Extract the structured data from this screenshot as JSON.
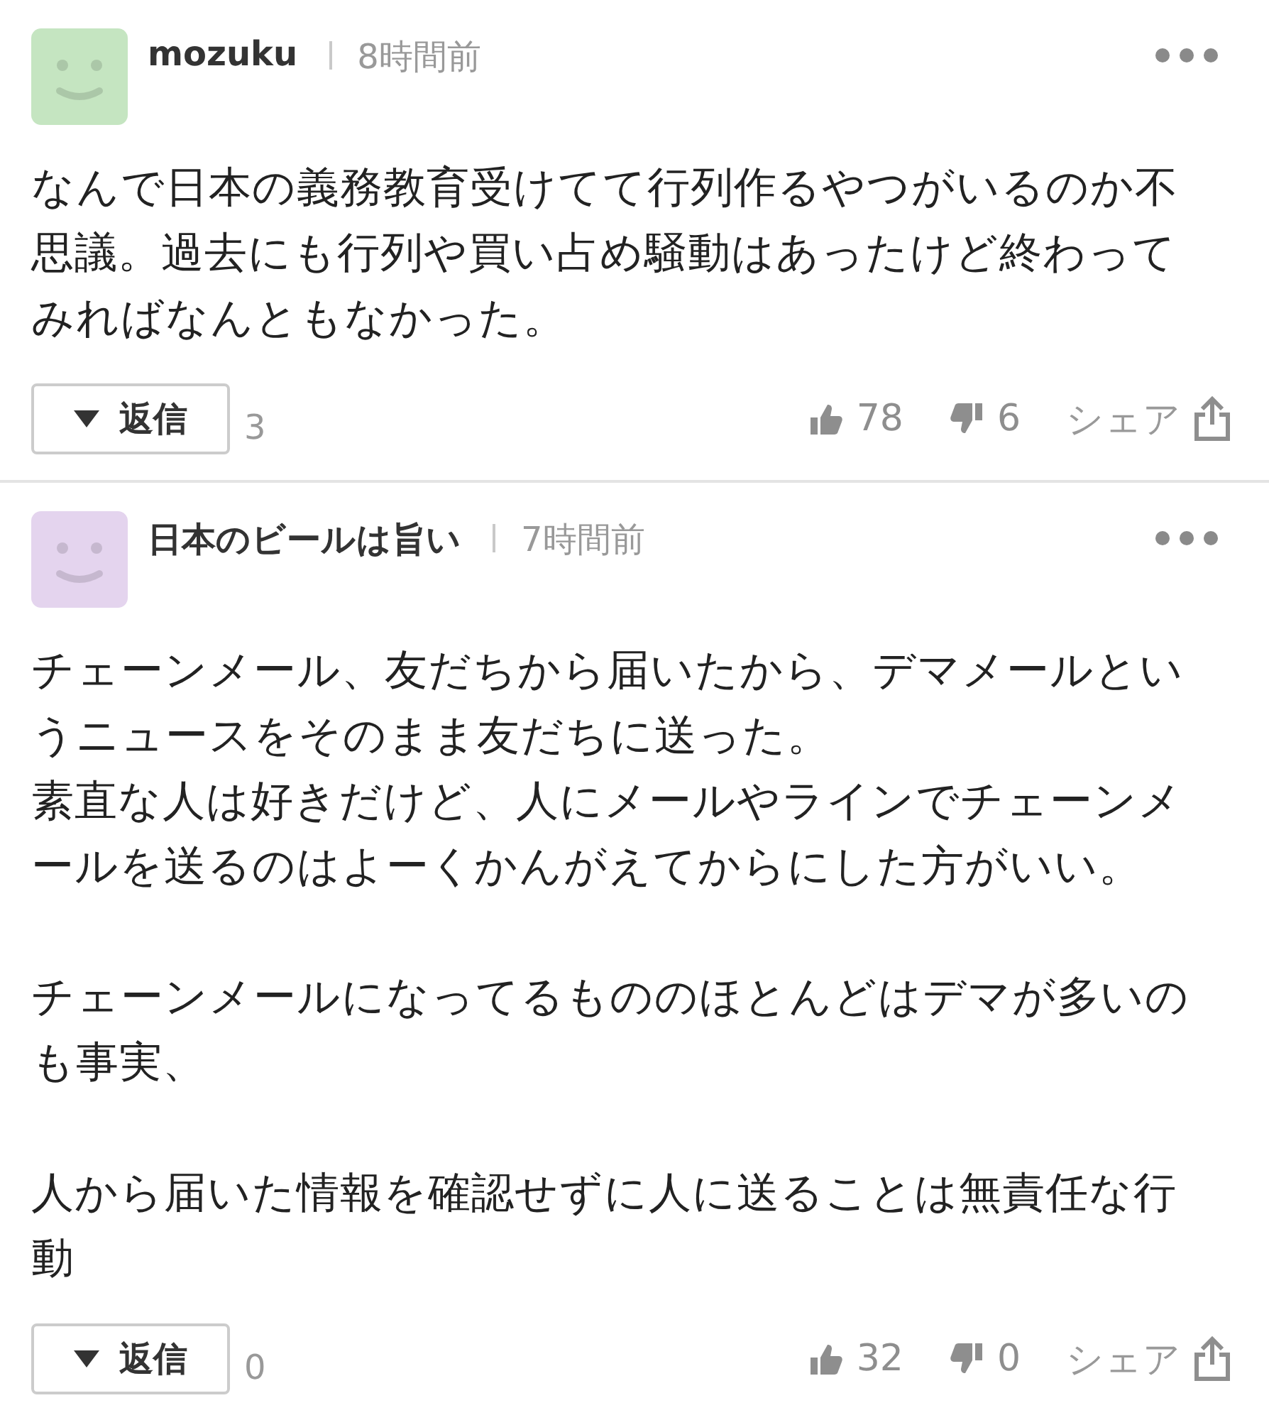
{
  "comments": [
    {
      "color": "#c5e5c1",
      "author": "mozuku",
      "time": "8時間前",
      "paragraphs": [
        [
          "なんで日本の義務教育受けてて行列作るやつがいるのか不思議。過去にも行列や買い占め騒動はあったけど終わってみればなんともなかった。"
        ]
      ],
      "reply_label": "返信",
      "reply_count": "3",
      "likes": "78",
      "dislikes": "6",
      "share_label": "シェア"
    },
    {
      "color": "#e4d4ee",
      "author": "日本のビールは旨い",
      "time": "7時間前",
      "paragraphs": [
        [
          "チェーンメール、友だちから届いたから、デマメールというニュースをそのまま友だちに送った。",
          "素直な人は好きだけど、人にメールやラインでチェーンメールを送るのはよーくかんがえてからにした方がいい。"
        ],
        [
          "チェーンメールになってるもののほとんどはデマが多いのも事実、"
        ],
        [
          "人から届いた情報を確認せずに人に送ることは無責任な行動"
        ]
      ],
      "reply_label": "返信",
      "reply_count": "0",
      "likes": "32",
      "dislikes": "0",
      "share_label": "シェア"
    }
  ]
}
